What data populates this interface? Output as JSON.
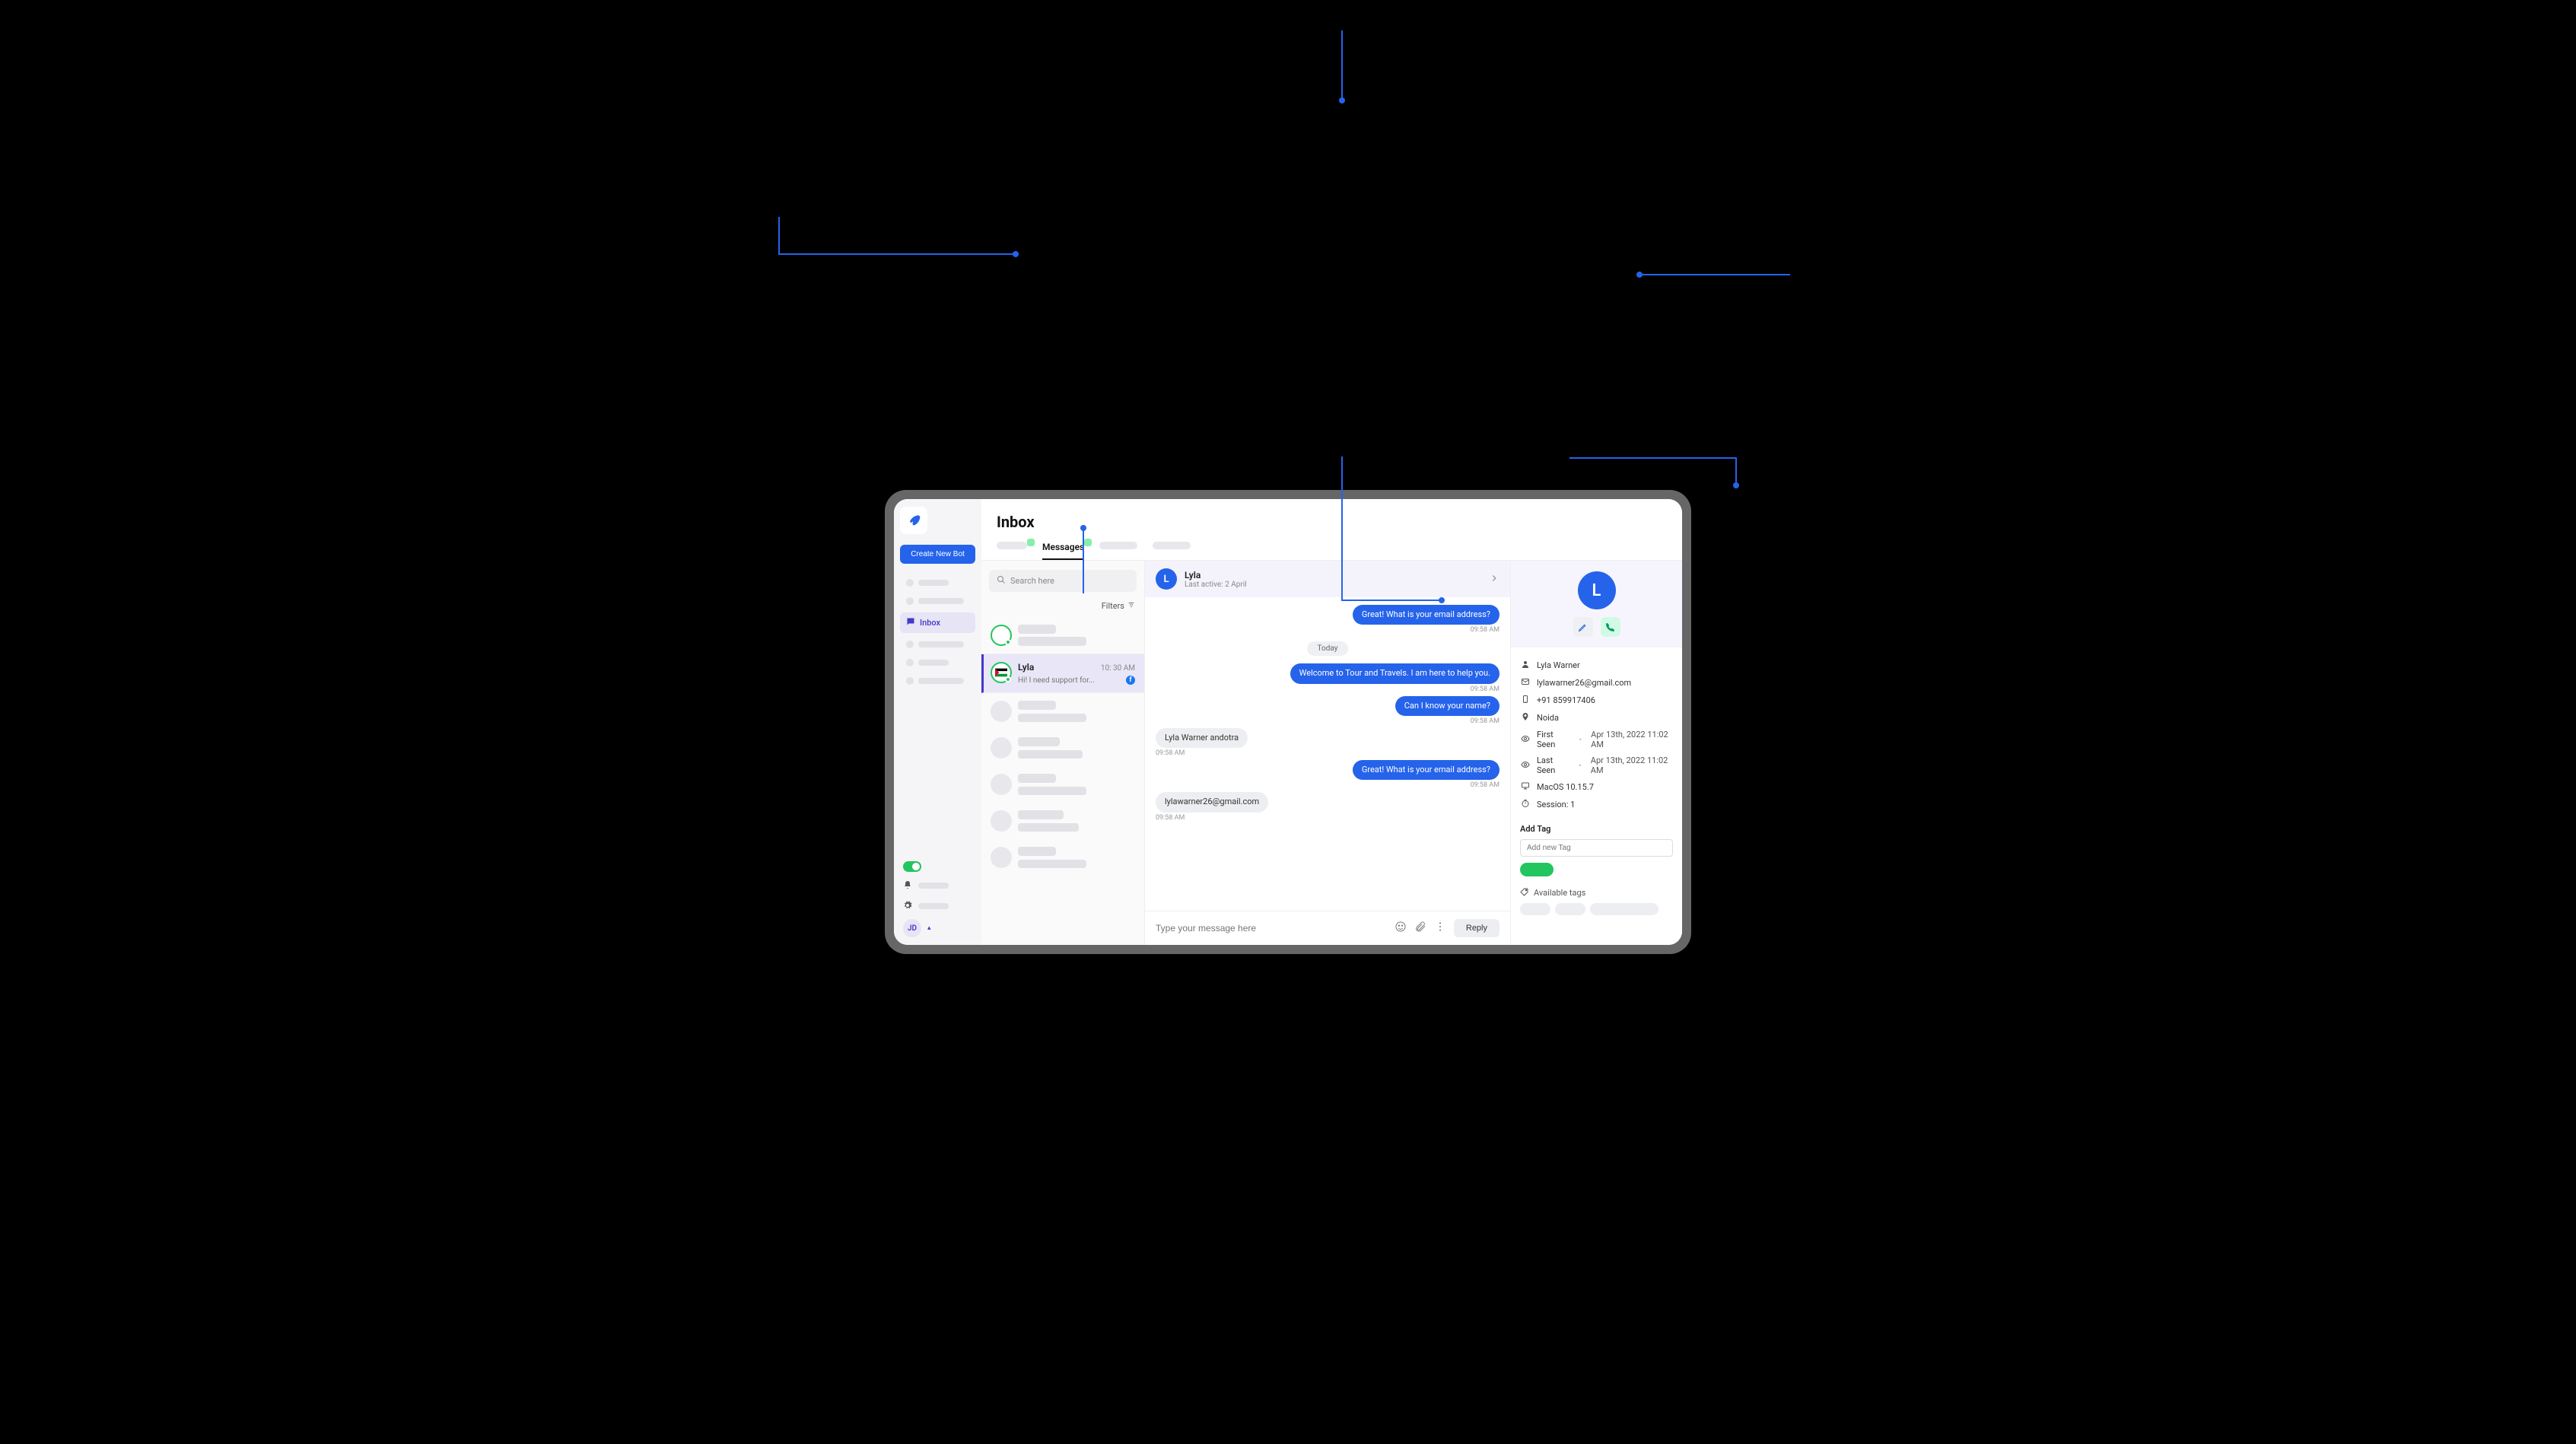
{
  "sidebar": {
    "create_bot": "Create New Bot",
    "inbox_label": "Inbox",
    "user_initials": "JD"
  },
  "header": {
    "title": "Inbox"
  },
  "tabs": {
    "messages": "Messages"
  },
  "search": {
    "placeholder": "Search here"
  },
  "filters": {
    "label": "Filters"
  },
  "threads": {
    "selected": {
      "name": "Lyla",
      "preview": "Hi! I need support for...",
      "time": "10: 30 AM"
    }
  },
  "chat": {
    "name": "Lyla",
    "last_active": "Last active: 2 April",
    "avatar_letter": "L",
    "date_label": "Today",
    "messages": [
      {
        "dir": "out",
        "text": "Great! What is your email address?",
        "time": "09:58 AM"
      },
      {
        "dir": "out",
        "text": "Welcome to Tour and Travels. I am here to help you.",
        "time": "09:58 AM"
      },
      {
        "dir": "out",
        "text": "Can I know your name?",
        "time": "09:58 AM"
      },
      {
        "dir": "in",
        "text": "Lyla Warner andotra",
        "time": "09:58 AM"
      },
      {
        "dir": "out",
        "text": "Great! What is your email address?",
        "time": "09:58 AM"
      },
      {
        "dir": "in",
        "text": "lylawarner26@gmail.com",
        "time": "09:58 AM"
      }
    ],
    "composer_placeholder": "Type your message here",
    "reply_label": "Reply"
  },
  "details": {
    "avatar_letter": "L",
    "name": "Lyla Warner",
    "email": "lylawarner26@gmail.com",
    "phone": "+91 859917406",
    "location": "Noida",
    "first_seen_label": "First Seen",
    "first_seen_value": "Apr 13th, 2022 11:02 AM",
    "last_seen_label": "Last Seen",
    "last_seen_value": "Apr 13th, 2022 11:02 AM",
    "os": "MacOS 10.15.7",
    "session": "Session: 1",
    "add_tag_label": "Add Tag",
    "add_tag_placeholder": "Add new Tag",
    "available_tags_label": "Available tags"
  }
}
